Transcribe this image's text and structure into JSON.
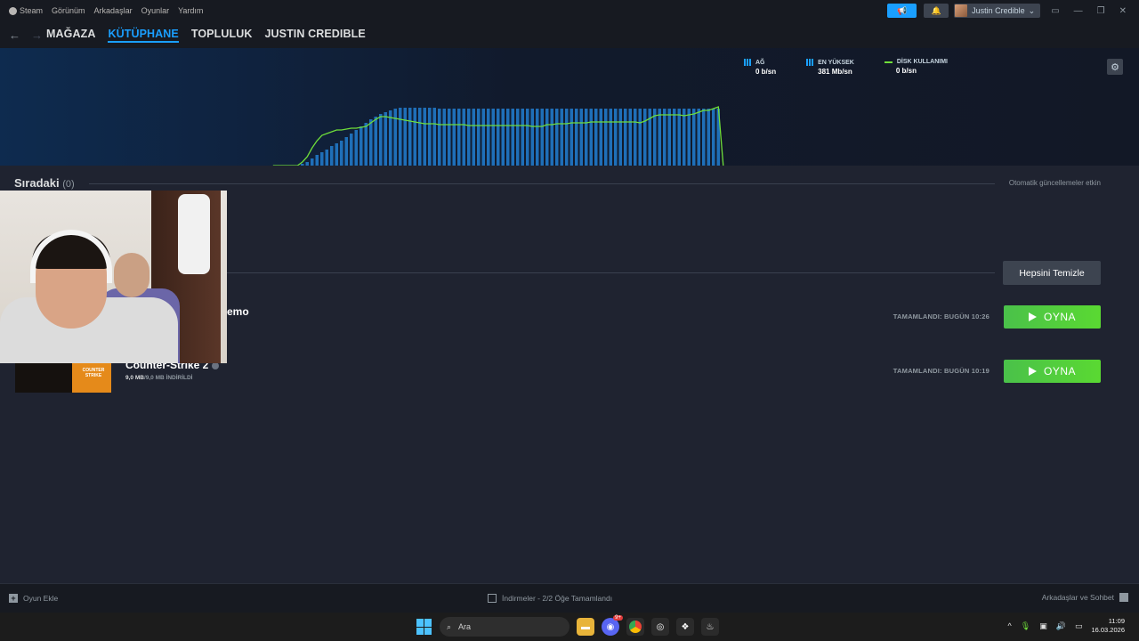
{
  "menu": {
    "items": [
      "Steam",
      "Görünüm",
      "Arkadaşlar",
      "Oyunlar",
      "Yardım"
    ]
  },
  "user": {
    "name": "Justin Credible"
  },
  "nav": {
    "links": [
      {
        "label": "MAĞAZA",
        "active": false
      },
      {
        "label": "KÜTÜPHANE",
        "active": true
      },
      {
        "label": "TOPLULUK",
        "active": false
      },
      {
        "label": "JUSTIN CREDIBLE",
        "active": false
      }
    ]
  },
  "stats": {
    "network": {
      "label": "AĞ",
      "value": "0 b/sn"
    },
    "peak": {
      "label": "EN YÜKSEK",
      "value": "381 Mb/sn"
    },
    "disk": {
      "label": "DİSK KULLANIMI",
      "value": "0 b/sn"
    }
  },
  "chart_data": {
    "type": "bar",
    "series": [
      {
        "name": "AĞ",
        "values": [
          0,
          0,
          0,
          0,
          0,
          0,
          2,
          4,
          8,
          12,
          15,
          18,
          22,
          25,
          28,
          32,
          36,
          40,
          44,
          48,
          52,
          55,
          58,
          60,
          62,
          64,
          65,
          65,
          65,
          65,
          65,
          65,
          65,
          65,
          64,
          64,
          64,
          64,
          64,
          64,
          64,
          64,
          64,
          64,
          64,
          64,
          64,
          64,
          64,
          64,
          64,
          64,
          64,
          64,
          64,
          64,
          64,
          64,
          64,
          64,
          64,
          64,
          64,
          64,
          64,
          64,
          64,
          64,
          64,
          64,
          64,
          64,
          64,
          64,
          64,
          64,
          64,
          64,
          64,
          64,
          64,
          64,
          64,
          64,
          64,
          64,
          64,
          64,
          64,
          64,
          64,
          64,
          0
        ]
      },
      {
        "name": "DİSK KULLANIMI",
        "values": [
          0,
          0,
          0,
          0,
          0,
          0,
          4,
          10,
          20,
          28,
          34,
          36,
          38,
          40,
          40,
          41,
          42,
          42,
          43,
          44,
          48,
          52,
          55,
          55,
          54,
          53,
          52,
          51,
          50,
          49,
          48,
          47,
          47,
          47,
          46,
          46,
          46,
          46,
          46,
          46,
          45,
          45,
          45,
          45,
          45,
          45,
          45,
          45,
          45,
          45,
          45,
          45,
          45,
          44,
          44,
          44,
          46,
          46,
          47,
          47,
          47,
          48,
          48,
          48,
          48,
          49,
          49,
          49,
          49,
          49,
          49,
          49,
          49,
          49,
          49,
          48,
          50,
          53,
          56,
          57,
          57,
          57,
          57,
          57,
          56,
          57,
          58,
          60,
          62,
          62,
          64,
          66,
          0
        ]
      }
    ]
  },
  "queue": {
    "title": "Sıradaki",
    "count": "(0)",
    "auto_updates": "Otomatik güncellemeler etkin"
  },
  "completed": {
    "clear_label": "Hepsini Temizle",
    "items": [
      {
        "title": "emo",
        "status": "TAMAMLANDI: BUGÜN 10:26",
        "play_label": "OYNA"
      },
      {
        "title": "Counter-Strike 2",
        "size_done": "9,0 MB",
        "size_total": "/9,0 MB İNDİRİLDİ",
        "status": "TAMAMLANDI: BUGÜN 10:19",
        "play_label": "OYNA",
        "thumb_text": "COUNTER STRIKE"
      }
    ]
  },
  "footer": {
    "add_game": "Oyun Ekle",
    "downloads": "İndirmeler - 2/2 Öğe Tamamlandı",
    "friends": "Arkadaşlar ve Sohbet"
  },
  "taskbar": {
    "search_placeholder": "Ara",
    "discord_badge": "9+",
    "time": "11:09",
    "date": "16.03.2026"
  }
}
